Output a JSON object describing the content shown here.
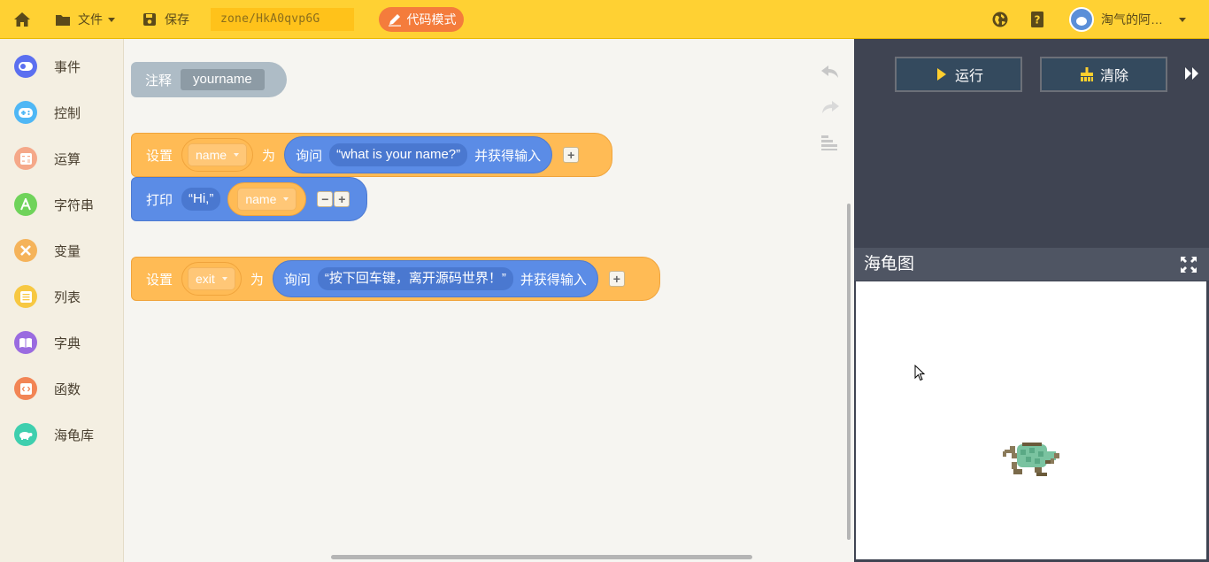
{
  "toolbar": {
    "file_label": "文件",
    "save_label": "保存",
    "zone_text": "zone/HkA0qvp6G",
    "code_mode_label": "代码模式",
    "username": "淘气的阿…"
  },
  "sidebar": {
    "items": [
      {
        "label": "事件",
        "color": "#5b6ff0"
      },
      {
        "label": "控制",
        "color": "#4fb7f5"
      },
      {
        "label": "运算",
        "color": "#f5a889"
      },
      {
        "label": "字符串",
        "color": "#6fd35a"
      },
      {
        "label": "变量",
        "color": "#f5b35a"
      },
      {
        "label": "列表",
        "color": "#f7c842"
      },
      {
        "label": "字典",
        "color": "#9a6be0"
      },
      {
        "label": "函数",
        "color": "#f28555"
      },
      {
        "label": "海龟库",
        "color": "#3ecfae"
      }
    ]
  },
  "blocks": {
    "comment": {
      "keyword": "注释",
      "value": "yourname"
    },
    "set1": {
      "keyword": "设置",
      "var": "name",
      "as": "为",
      "ask": "询问",
      "prompt": "“what is your name?”",
      "suffix": "并获得输入"
    },
    "print": {
      "keyword": "打印",
      "str": "“Hi,”",
      "var": "name"
    },
    "set2": {
      "keyword": "设置",
      "var": "exit",
      "as": "为",
      "ask": "询问",
      "prompt": "“按下回车键，离开源码世界！”",
      "suffix": "并获得输入"
    }
  },
  "panel": {
    "run_label": "运行",
    "clear_label": "清除",
    "turtle_title": "海龟图"
  },
  "colors": {
    "topbar": "#ffd133",
    "code_mode": "#f47c3c",
    "set_block": "#ffbb55",
    "blue_block": "#5b8ce6",
    "panel_bg": "#3f4452"
  }
}
